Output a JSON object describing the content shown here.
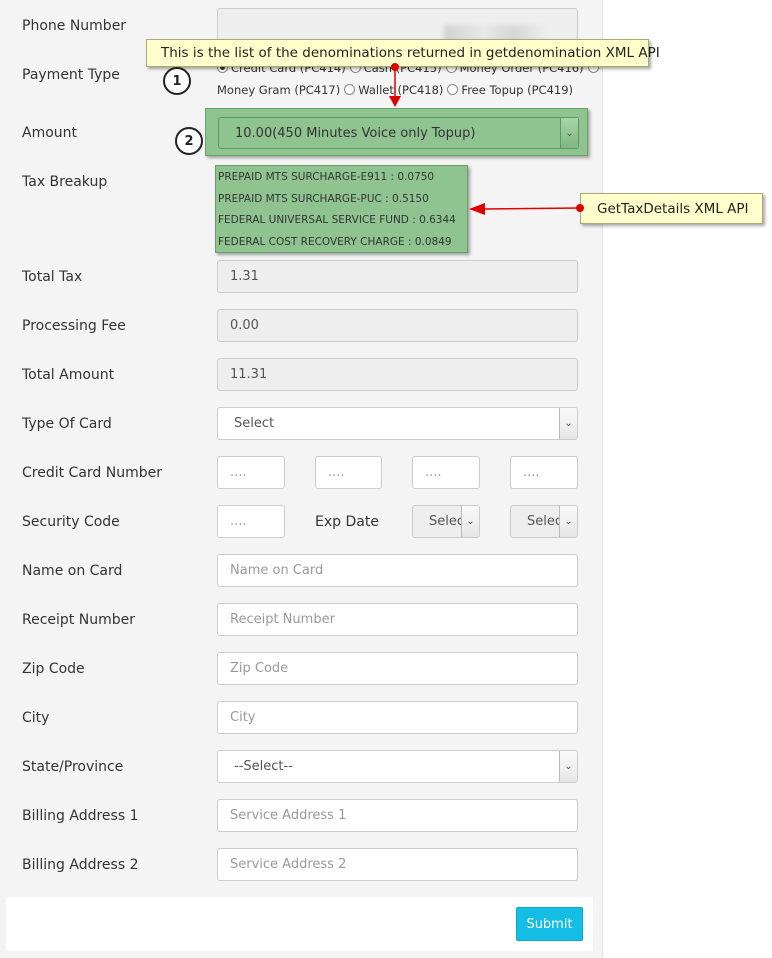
{
  "labels": {
    "phone": "Phone Number",
    "payment_type": "Payment Type",
    "amount": "Amount",
    "tax_breakup": "Tax Breakup",
    "total_tax": "Total Tax",
    "processing_fee": "Processing Fee",
    "total_amount": "Total Amount",
    "type_of_card": "Type Of Card",
    "cc_number": "Credit Card Number",
    "security_code": "Security Code",
    "exp_date": "Exp Date",
    "name_on_card": "Name on Card",
    "receipt_number": "Receipt Number",
    "zip_code": "Zip Code",
    "city": "City",
    "state": "State/Province",
    "billing1": "Billing Address 1",
    "billing2": "Billing Address 2"
  },
  "payment_options": {
    "credit_card": "Credit Card (PC414)",
    "cash": "Cash (PC415)",
    "money_order": "Money Order (PC416)",
    "money_gram": "Money Gram (PC417)",
    "wallet": "Wallet (PC418)",
    "free_topup": "Free Topup (PC419)"
  },
  "amount_selected": "10.00(450 Minutes Voice only Topup)",
  "tax_lines": [
    "PREPAID MTS SURCHARGE-E911 : 0.0750",
    "PREPAID MTS SURCHARGE-PUC : 0.5150",
    "FEDERAL UNIVERSAL SERVICE FUND : 0.6344",
    "FEDERAL COST RECOVERY CHARGE : 0.0849"
  ],
  "values": {
    "total_tax": "1.31",
    "processing_fee": "0.00",
    "total_amount": "11.31"
  },
  "selects": {
    "type_of_card": "Select",
    "exp_month": "Select",
    "exp_year": "Select",
    "state": "--Select--"
  },
  "placeholders": {
    "cc_part": "....",
    "security_code": "....",
    "name_on_card": "Name on Card",
    "receipt_number": "Receipt Number",
    "zip_code": "Zip Code",
    "city": "City",
    "billing1": "Service Address 1",
    "billing2": "Service Address 2"
  },
  "submit_label": "Submit",
  "annotations": {
    "denominations_note": "This is the list of the denominations returned in getdenomination XML API",
    "tax_note": "GetTaxDetails XML API",
    "step1": "1",
    "step2": "2"
  },
  "colors": {
    "highlight_green": "#8fc490",
    "callout_yellow": "#ffffcc",
    "arrow_red": "#e00000",
    "submit_blue": "#14bde3"
  }
}
